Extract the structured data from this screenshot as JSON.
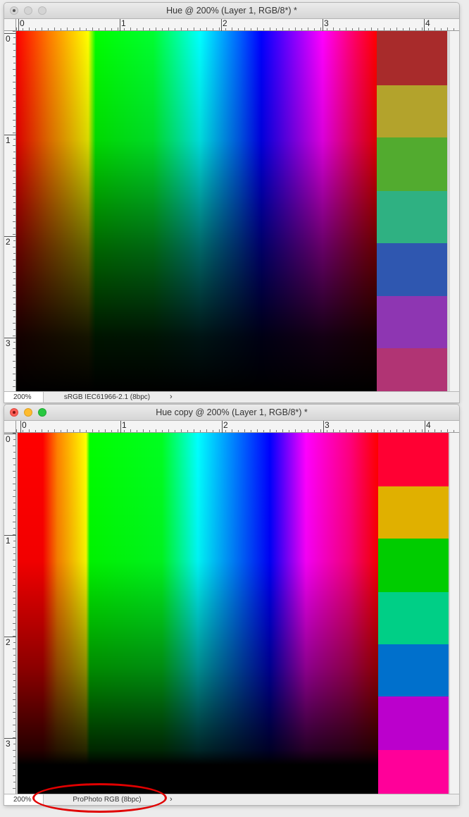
{
  "windows": [
    {
      "title": "Hue @ 200% (Layer 1, RGB/8*) *",
      "zoom": "200%",
      "profile": "sRGB IEC61966-2.1 (8bpc)",
      "swatches": [
        "#a82b2b",
        "#b3a32c",
        "#52ab2f",
        "#2fb182",
        "#2f57b0",
        "#8e36b2",
        "#b13474"
      ],
      "ruler_h": [
        "0",
        "1",
        "2",
        "3",
        "4"
      ],
      "ruler_v": [
        "0",
        "1",
        "2",
        "3"
      ]
    },
    {
      "title": "Hue copy @ 200% (Layer 1, RGB/8*) *",
      "zoom": "200%",
      "profile": "ProPhoto RGB (8bpc)",
      "swatches": [
        "#ff0033",
        "#e0b000",
        "#00cc00",
        "#00cf86",
        "#0070cc",
        "#bb00cc",
        "#ff0099"
      ],
      "ruler_h": [
        "0",
        "1",
        "2",
        "3",
        "4"
      ],
      "ruler_v": [
        "0",
        "1",
        "2",
        "3"
      ]
    }
  ],
  "status_arrow": "›",
  "colors": {
    "highlight": "#e00000"
  }
}
